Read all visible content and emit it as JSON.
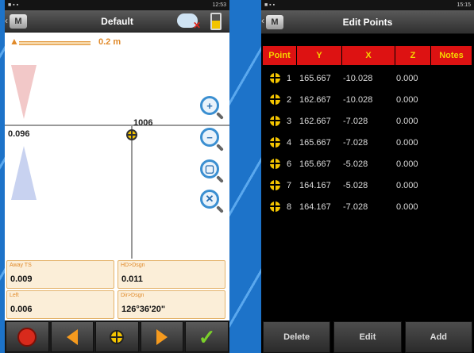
{
  "left": {
    "status": {
      "time": "12:53",
      "battery": "79%"
    },
    "title": "Default",
    "scale": {
      "label": "0.2 m"
    },
    "map": {
      "offset_value": "0.096",
      "point_label": "1006"
    },
    "readouts": [
      {
        "label": "Away TS",
        "value": "0.009"
      },
      {
        "label": "HD>Dsgn",
        "value": "0.011"
      },
      {
        "label": "Left",
        "value": "0.006"
      },
      {
        "label": "Dir>Dsgn",
        "value": "126°36'20\""
      }
    ]
  },
  "right": {
    "status": {
      "time": "15:15",
      "battery": "59%"
    },
    "title": "Edit Points",
    "columns": [
      "Point",
      "Y",
      "X",
      "Z",
      "Notes"
    ],
    "rows": [
      {
        "point": "1",
        "y": "165.667",
        "x": "-10.028",
        "z": "0.000"
      },
      {
        "point": "2",
        "y": "162.667",
        "x": "-10.028",
        "z": "0.000"
      },
      {
        "point": "3",
        "y": "162.667",
        "x": "-7.028",
        "z": "0.000"
      },
      {
        "point": "4",
        "y": "165.667",
        "x": "-7.028",
        "z": "0.000"
      },
      {
        "point": "6",
        "y": "165.667",
        "x": "-5.028",
        "z": "0.000"
      },
      {
        "point": "7",
        "y": "164.167",
        "x": "-5.028",
        "z": "0.000"
      },
      {
        "point": "8",
        "y": "164.167",
        "x": "-7.028",
        "z": "0.000"
      }
    ],
    "buttons": {
      "delete": "Delete",
      "edit": "Edit",
      "add": "Add"
    }
  },
  "colors": {
    "header_red": "#dd1212",
    "header_text": "#f6d400",
    "accent_orange": "#e08a2a",
    "point_yellow": "#f3c400"
  },
  "icons": [
    "stop-icon",
    "arrow-left-icon",
    "target-icon",
    "arrow-right-icon",
    "check-icon",
    "zoom-in-icon",
    "zoom-out-icon",
    "zoom-window-icon",
    "zoom-extents-icon",
    "cloud-disconnected-icon",
    "battery-icon",
    "north-arrow-icon"
  ]
}
